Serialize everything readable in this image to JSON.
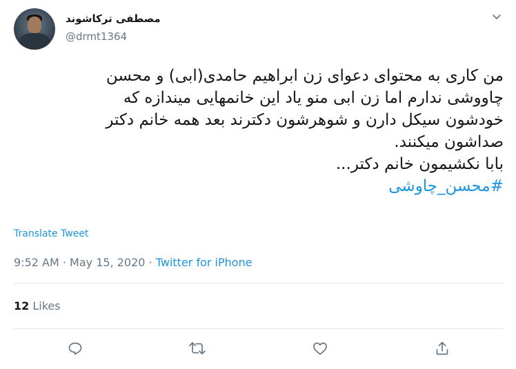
{
  "tweet": {
    "display_name": "مصطفی ترکاشوند",
    "handle": "@drmt1364",
    "text_lines": [
      "من کاری به محتوای دعوای زن ابراهیم حامدی(ابی) و محسن",
      "چاووشی ندارم اما زن ابی منو یاد این خانمهایی میندازه که",
      "خودشون سیکل دارن و شوهرشون دکترند بعد همه خانم دکتر",
      "صداشون میکنند.",
      "بابا نکشیمون خانم دکتر..."
    ],
    "hashtag": "#محسن_چاوشی",
    "translate_label": "Translate Tweet",
    "time": "9:52 AM",
    "separator": "·",
    "date": "May 15, 2020",
    "source": "Twitter for iPhone",
    "likes_count": "12",
    "likes_label": "Likes"
  },
  "icons": {
    "caret": "chevron-down-icon",
    "reply": "reply-icon",
    "retweet": "retweet-icon",
    "like": "heart-icon",
    "share": "share-icon"
  },
  "colors": {
    "link": "#1b95e0",
    "secondary_text": "#657786",
    "primary_text": "#14171a",
    "divider": "#e1e8ed"
  }
}
